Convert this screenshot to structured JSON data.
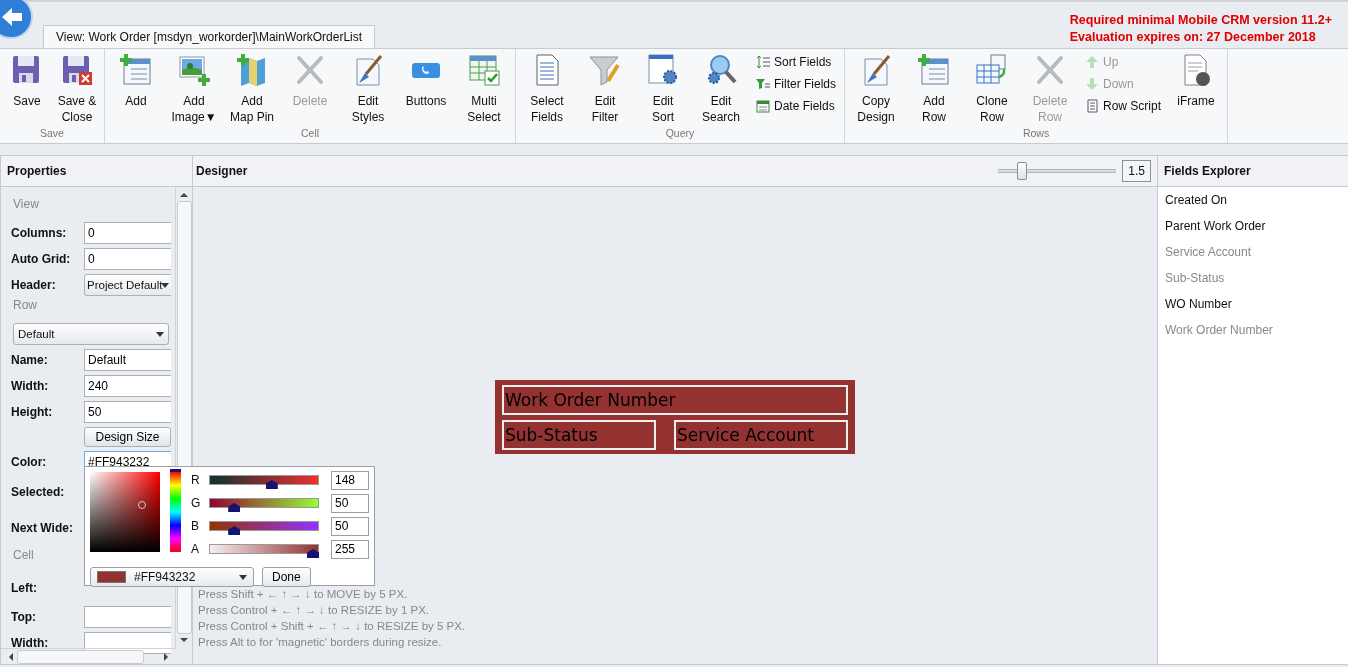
{
  "top_bar": {
    "tab": "View: Work Order [msdyn_workorder]\\MainWorkOrderList",
    "notices": [
      "Required minimal Mobile CRM version 11.2+",
      "Evaluation expires on: 27 December 2018"
    ]
  },
  "ribbon": [
    {
      "label": "Save",
      "items": [
        {
          "kind": "large",
          "lines": [
            "Save"
          ],
          "disabled": false
        },
        {
          "kind": "large",
          "lines": [
            "Save &",
            "Close"
          ],
          "disabled": false
        }
      ]
    },
    {
      "label": "Cell",
      "items": [
        {
          "kind": "large",
          "lines": [
            "Add"
          ],
          "disabled": false
        },
        {
          "kind": "large",
          "lines": [
            "Add",
            "Image▼"
          ],
          "disabled": false
        },
        {
          "kind": "large",
          "lines": [
            "Add",
            "Map Pin"
          ],
          "disabled": false
        },
        {
          "kind": "large",
          "lines": [
            "Delete"
          ],
          "disabled": true
        },
        {
          "kind": "large",
          "lines": [
            "Edit",
            "Styles"
          ],
          "disabled": false
        },
        {
          "kind": "large",
          "lines": [
            "Buttons"
          ],
          "disabled": false
        },
        {
          "kind": "large",
          "lines": [
            "Multi",
            "Select"
          ],
          "disabled": false
        }
      ]
    },
    {
      "label": "Query",
      "items": [
        {
          "kind": "large",
          "lines": [
            "Select",
            "Fields"
          ],
          "disabled": false
        },
        {
          "kind": "large",
          "lines": [
            "Edit",
            "Filter"
          ],
          "disabled": false
        },
        {
          "kind": "large",
          "lines": [
            "Edit",
            "Sort"
          ],
          "disabled": false
        },
        {
          "kind": "large",
          "lines": [
            "Edit",
            "Search"
          ],
          "disabled": false
        },
        {
          "kind": "stack",
          "items": [
            {
              "label": "Sort Fields",
              "disabled": false
            },
            {
              "label": "Filter Fields",
              "disabled": false
            },
            {
              "label": "Date Fields",
              "disabled": false
            }
          ]
        }
      ]
    },
    {
      "label": "Rows",
      "items": [
        {
          "kind": "large",
          "lines": [
            "Copy",
            "Design"
          ],
          "disabled": false
        },
        {
          "kind": "large",
          "lines": [
            "Add",
            "Row"
          ],
          "disabled": false
        },
        {
          "kind": "large",
          "lines": [
            "Clone",
            "Row"
          ],
          "disabled": false
        },
        {
          "kind": "large",
          "lines": [
            "Delete",
            "Row"
          ],
          "disabled": true
        },
        {
          "kind": "stack",
          "items": [
            {
              "label": "Up",
              "disabled": true
            },
            {
              "label": "Down",
              "disabled": true
            },
            {
              "label": "Row Script",
              "disabled": false
            }
          ]
        },
        {
          "kind": "large",
          "lines": [
            "iFrame"
          ],
          "disabled": false
        }
      ]
    }
  ],
  "properties": {
    "title": "Properties",
    "rows": [
      {
        "kind": "section",
        "label": "View"
      },
      {
        "kind": "field",
        "label": "Columns:",
        "value": "0",
        "focused": false
      },
      {
        "kind": "field",
        "label": "Auto Grid:",
        "value": "0",
        "focused": false
      },
      {
        "kind": "select",
        "label": "Header:",
        "value": "Project Default"
      },
      {
        "kind": "section",
        "label": "Row"
      },
      {
        "kind": "select",
        "value": "Default"
      },
      {
        "kind": "field",
        "label": "Name:",
        "value": "Default",
        "focused": false
      },
      {
        "kind": "field",
        "label": "Width:",
        "value": "240",
        "focused": false
      },
      {
        "kind": "field",
        "label": "Height:",
        "value": "50",
        "focused": false
      },
      {
        "kind": "button",
        "value": "Design Size"
      },
      {
        "kind": "field",
        "label": "Color:",
        "value": "#FF943232",
        "focused": true
      },
      {
        "kind": "label",
        "label": "Selected:"
      },
      {
        "kind": "label",
        "label": "Next Wide:"
      },
      {
        "kind": "section",
        "label": "Cell"
      },
      {
        "kind": "label",
        "label": "Left:"
      },
      {
        "kind": "field",
        "label": "Top:",
        "focused": false
      },
      {
        "kind": "field",
        "label": "Width:",
        "focused": false
      }
    ]
  },
  "color_picker": {
    "channels": [
      {
        "label": "R",
        "value": "148",
        "level": 0.58
      },
      {
        "label": "G",
        "value": "50",
        "level": 0.196
      },
      {
        "label": "B",
        "value": "50",
        "level": 0.196
      },
      {
        "label": "A",
        "value": "255",
        "level": 1
      }
    ],
    "hex": "#FF943232",
    "done": "Done"
  },
  "designer": {
    "title": "Designer",
    "zoom": {
      "level": 0.17,
      "value": "1.5"
    },
    "card_rows": [
      [
        "Work Order Number"
      ],
      [
        "Sub-Status",
        "Service Account"
      ]
    ],
    "hints": [
      "Press Shift + ← ↑ → ↓ to MOVE by 5 PX.",
      "Press Control + ← ↑ → ↓ to RESIZE by 1 PX.",
      "Press Control + Shift + ← ↑ → ↓ to RESIZE by 5 PX.",
      "Press Alt to for 'magnetic' borders during resize."
    ]
  },
  "fields_explorer": {
    "title": "Fields Explorer",
    "items": [
      {
        "label": "Created On",
        "disabled": false
      },
      {
        "label": "Parent Work Order",
        "disabled": false
      },
      {
        "label": "Service Account",
        "disabled": true
      },
      {
        "label": "Sub-Status",
        "disabled": true
      },
      {
        "label": "WO Number",
        "disabled": false
      },
      {
        "label": "Work Order Number",
        "disabled": true
      }
    ]
  }
}
